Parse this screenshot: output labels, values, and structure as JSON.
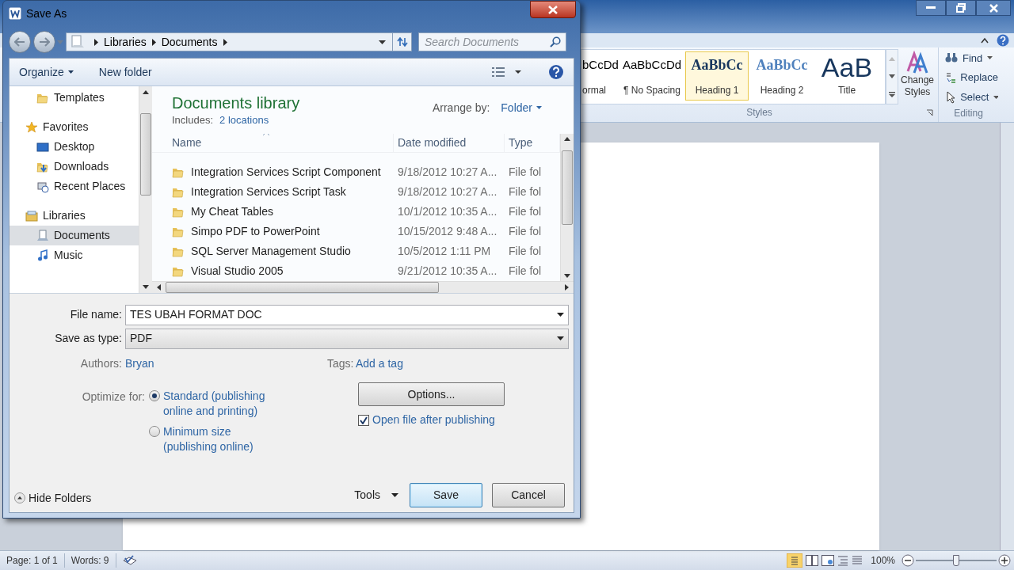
{
  "word": {
    "ribbon": {
      "styles": [
        {
          "preview": "bCcDd",
          "label": "ormal",
          "kind": "normal",
          "selected": false
        },
        {
          "preview": "AaBbCcDd",
          "label": "¶ No Spacing",
          "kind": "normal",
          "selected": false
        },
        {
          "preview": "AaBbCc",
          "label": "Heading 1",
          "kind": "heading1",
          "selected": true
        },
        {
          "preview": "AaBbCc",
          "label": "Heading 2",
          "kind": "heading2",
          "selected": false
        },
        {
          "preview": "AaB",
          "label": "Title",
          "kind": "title",
          "selected": false
        }
      ],
      "change_styles": "Change Styles",
      "styles_group": "Styles",
      "editing": [
        {
          "label": "Find",
          "kind": "find",
          "dropdown": true
        },
        {
          "label": "Replace",
          "kind": "replace",
          "dropdown": false
        },
        {
          "label": "Select",
          "kind": "select",
          "dropdown": true
        }
      ],
      "editing_group": "Editing"
    },
    "status_bar": {
      "page": "Page: 1 of 1",
      "words": "Words: 9",
      "zoom": "100%",
      "zoom_level": {
        "level": 0.5
      }
    }
  },
  "dialog": {
    "title": "Save As",
    "breadcrumb": [
      "Libraries",
      "Documents"
    ],
    "search": {
      "placeholder": "Search Documents"
    },
    "toolbar": {
      "organize": "Organize",
      "new_folder": "New folder"
    },
    "nav": [
      {
        "label": "Templates",
        "kind": "folder",
        "selected": false
      },
      {
        "label": "Favorites",
        "kind": "favorites",
        "selected": false,
        "children": [
          {
            "label": "Desktop",
            "kind": "desktop",
            "selected": false
          },
          {
            "label": "Downloads",
            "kind": "downloads",
            "selected": false
          },
          {
            "label": "Recent Places",
            "kind": "recent",
            "selected": false
          }
        ]
      },
      {
        "label": "Libraries",
        "kind": "libraries",
        "selected": false,
        "children": [
          {
            "label": "Documents",
            "kind": "documents",
            "selected": true
          },
          {
            "label": "Music",
            "kind": "music",
            "selected": false
          }
        ]
      }
    ],
    "library": {
      "title": "Documents library",
      "includes_label": "Includes:",
      "includes_link": "2 locations",
      "arrange_label": "Arrange by:",
      "arrange_value": "Folder"
    },
    "columns": [
      "Name",
      "Date modified",
      "Type"
    ],
    "rows": [
      {
        "name": "Integration Services Script Component",
        "date": "9/18/2012 10:27 A...",
        "type": "File fol"
      },
      {
        "name": "Integration Services Script Task",
        "date": "9/18/2012 10:27 A...",
        "type": "File fol"
      },
      {
        "name": "My Cheat Tables",
        "date": "10/1/2012 10:35 A...",
        "type": "File fol"
      },
      {
        "name": "Simpo PDF to PowerPoint",
        "date": "10/15/2012 9:48 A...",
        "type": "File fol"
      },
      {
        "name": "SQL Server Management Studio",
        "date": "10/5/2012 1:11 PM",
        "type": "File fol"
      },
      {
        "name": "Visual Studio 2005",
        "date": "9/21/2012 10:35 A...",
        "type": "File fol"
      }
    ],
    "form": {
      "file_name_label": "File name:",
      "file_name": "TES UBAH FORMAT DOC",
      "type_label": "Save as type:",
      "type_value": "PDF",
      "authors_label": "Authors:",
      "authors": "Bryan",
      "tags_label": "Tags:",
      "tags": "Add a tag",
      "optimize_label": "Optimize for:",
      "optimize": [
        {
          "lines": [
            "Standard (publishing",
            "online and printing)"
          ],
          "selected": true
        },
        {
          "lines": [
            "Minimum size",
            "(publishing online)"
          ],
          "selected": false
        }
      ],
      "options_button": "Options...",
      "open_after": {
        "label": "Open file after publishing",
        "checked": true
      }
    },
    "hide_folders": "Hide Folders",
    "tools": "Tools",
    "save": "Save",
    "cancel": "Cancel"
  }
}
